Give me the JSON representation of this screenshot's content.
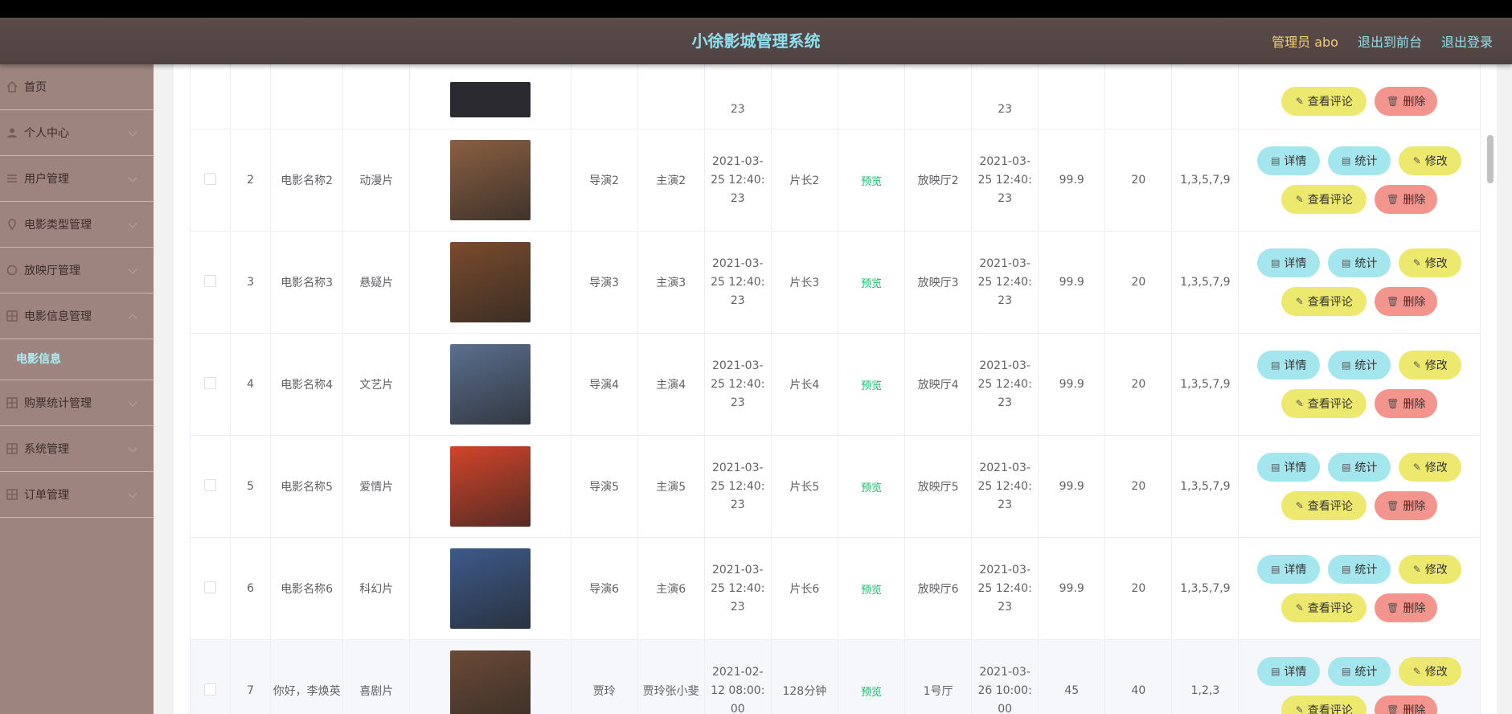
{
  "app": {
    "title": "小徐影城管理系统",
    "admin": "管理员 abo",
    "back_front": "退出到前台",
    "logout": "退出登录"
  },
  "sidebar": {
    "items": [
      {
        "label": "首页",
        "icon": "home-icon"
      },
      {
        "label": "个人中心",
        "icon": "user-icon"
      },
      {
        "label": "用户管理",
        "icon": "list-icon"
      },
      {
        "label": "电影类型管理",
        "icon": "location-icon"
      },
      {
        "label": "放映厅管理",
        "icon": "circle-icon"
      },
      {
        "label": "电影信息管理",
        "icon": "grid-icon"
      },
      {
        "label": "购票统计管理",
        "icon": "grid-icon"
      },
      {
        "label": "系统管理",
        "icon": "grid-icon"
      },
      {
        "label": "订单管理",
        "icon": "grid-icon"
      }
    ],
    "active_sub": "电影信息"
  },
  "buttons": {
    "detail": "详情",
    "stats": "统计",
    "edit": "修改",
    "comments": "查看评论",
    "delete": "删除"
  },
  "table": {
    "first_row": {
      "time_tail": "23",
      "end_tail": "23"
    },
    "rows": [
      {
        "id": "2",
        "name": "电影名称2",
        "type": "动漫片",
        "director": "导演2",
        "actor": "主演2",
        "time": [
          "2021-03-",
          "25 12:40:",
          "23"
        ],
        "duration": "片长2",
        "status": "预览",
        "hall": "放映厅2",
        "end": [
          "2021-03-",
          "25 12:40:",
          "23"
        ],
        "price": "99.9",
        "seats": "20",
        "weeks": "1,3,5,7,9",
        "poster": "#8a5f42"
      },
      {
        "id": "3",
        "name": "电影名称3",
        "type": "悬疑片",
        "director": "导演3",
        "actor": "主演3",
        "time": [
          "2021-03-",
          "25 12:40:",
          "23"
        ],
        "duration": "片长3",
        "status": "预览",
        "hall": "放映厅3",
        "end": [
          "2021-03-",
          "25 12:40:",
          "23"
        ],
        "price": "99.9",
        "seats": "20",
        "weeks": "1,3,5,7,9",
        "poster": "#7a4b2c"
      },
      {
        "id": "4",
        "name": "电影名称4",
        "type": "文艺片",
        "director": "导演4",
        "actor": "主演4",
        "time": [
          "2021-03-",
          "25 12:40:",
          "23"
        ],
        "duration": "片长4",
        "status": "预览",
        "hall": "放映厅4",
        "end": [
          "2021-03-",
          "25 12:40:",
          "23"
        ],
        "price": "99.9",
        "seats": "20",
        "weeks": "1,3,5,7,9",
        "poster": "#5b6f8f"
      },
      {
        "id": "5",
        "name": "电影名称5",
        "type": "爱情片",
        "director": "导演5",
        "actor": "主演5",
        "time": [
          "2021-03-",
          "25 12:40:",
          "23"
        ],
        "duration": "片长5",
        "status": "预览",
        "hall": "放映厅5",
        "end": [
          "2021-03-",
          "25 12:40:",
          "23"
        ],
        "price": "99.9",
        "seats": "20",
        "weeks": "1,3,5,7,9",
        "poster": "#d2442a"
      },
      {
        "id": "6",
        "name": "电影名称6",
        "type": "科幻片",
        "director": "导演6",
        "actor": "主演6",
        "time": [
          "2021-03-",
          "25 12:40:",
          "23"
        ],
        "duration": "片长6",
        "status": "预览",
        "hall": "放映厅6",
        "end": [
          "2021-03-",
          "25 12:40:",
          "23"
        ],
        "price": "99.9",
        "seats": "20",
        "weeks": "1,3,5,7,9",
        "poster": "#3d5a8a"
      },
      {
        "id": "7",
        "name": "你好，李焕英",
        "type": "喜剧片",
        "director": "贾玲",
        "actor": "贾玲张小斐",
        "time": [
          "2021-02-",
          "12 08:00:",
          "00"
        ],
        "duration": "128分钟",
        "status": "预览",
        "hall": "1号厅",
        "end": [
          "2021-03-",
          "26 10:00:",
          "00"
        ],
        "price": "45",
        "seats": "40",
        "weeks": "1,2,3",
        "poster": "#6b4a36"
      }
    ]
  }
}
